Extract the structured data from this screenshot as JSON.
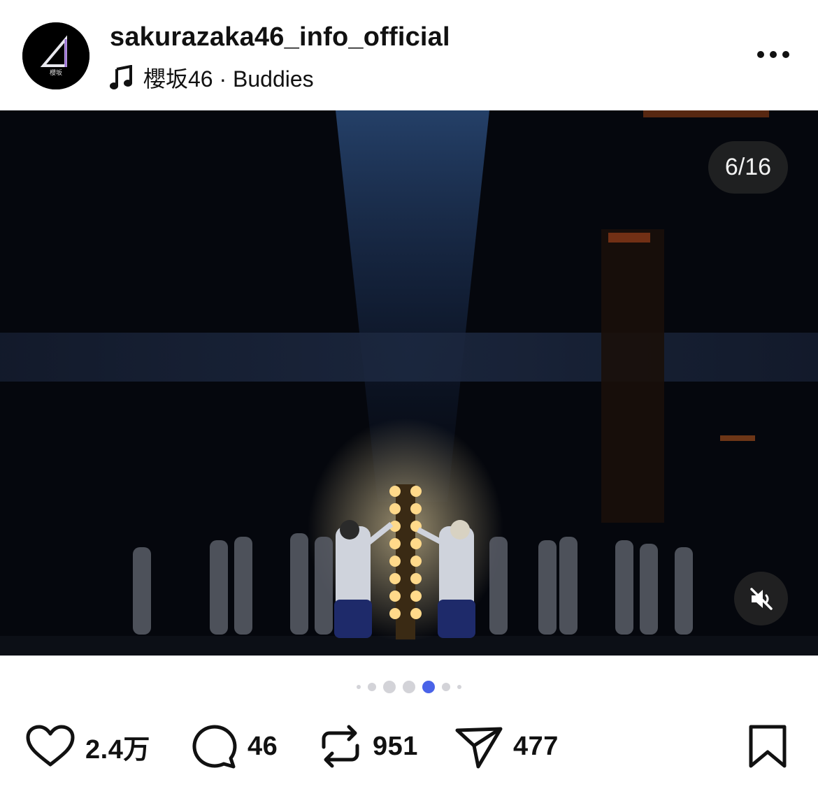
{
  "post": {
    "username": "sakurazaka46_info_official",
    "audio": "櫻坂46 · Buddies",
    "avatar_text": "櫻坂",
    "media_counter": "6/16",
    "carousel": {
      "total_visible_dots": 7,
      "active_index": 4
    }
  },
  "actions": {
    "likes": "2.4万",
    "comments": "46",
    "reposts": "951",
    "shares": "477"
  },
  "icons": {
    "audio": "music-note-icon",
    "more": "more-horizontal-icon",
    "mute": "speaker-muted-icon",
    "like": "heart-icon",
    "comment": "comment-bubble-icon",
    "repost": "repost-arrows-icon",
    "share": "paper-plane-icon",
    "save": "bookmark-icon"
  },
  "colors": {
    "active_dot": "#4a63e8",
    "inactive_dot": "#d3d3d8",
    "text": "#111111"
  }
}
